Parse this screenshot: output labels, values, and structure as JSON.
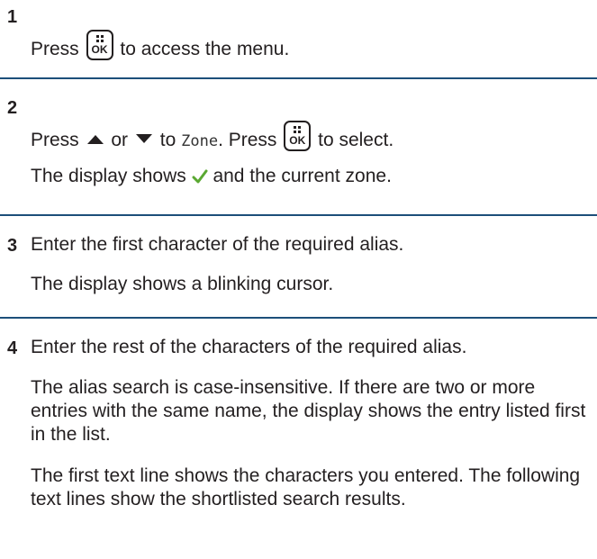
{
  "steps": [
    {
      "number": "1",
      "lines": [
        {
          "before": "Press",
          "key": "OK",
          "after": "to access the menu."
        }
      ]
    },
    {
      "number": "2",
      "line1": {
        "press": "Press",
        "or": "or",
        "to": "to",
        "zone": "Zone",
        "press2": ". Press",
        "key": "OK",
        "after": "to select."
      },
      "line2": {
        "before": "The display shows",
        "after": "and the current zone."
      }
    },
    {
      "number": "3",
      "text": "Enter the first character of the required alias.",
      "result": "The display shows a blinking cursor."
    },
    {
      "number": "4",
      "text": "Enter the rest of the characters of the required alias.",
      "para1": "The alias search is case-insensitive. If there are two or more entries with the same name, the display shows the entry listed first in the list.",
      "para2": "The first text line shows the characters you entered. The following text lines show the shortlisted search results."
    }
  ],
  "icons": {
    "ok_key": "menu-ok-key-icon",
    "up": "up-arrow-icon",
    "down": "down-arrow-icon",
    "check": "checkmark-icon"
  },
  "colors": {
    "separator": "#1c4f7a",
    "check": "#5aa832",
    "text": "#231f20"
  }
}
